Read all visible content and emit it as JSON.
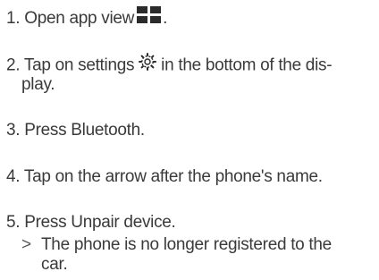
{
  "steps": [
    {
      "number": "1.",
      "before": "Open app view",
      "after": "."
    },
    {
      "number": "2.",
      "before": "Tap on settings",
      "after_line1": "in the bottom of the dis-",
      "line2": "play."
    },
    {
      "number": "3.",
      "text": "Press Bluetooth."
    },
    {
      "number": "4.",
      "text": "Tap on the arrow after the phone's name."
    },
    {
      "number": "5.",
      "text": "Press Unpair device."
    }
  ],
  "result": {
    "marker": ">",
    "line1": "The phone is no longer registered to the",
    "line2": "car."
  },
  "icons": {
    "app_view": "app-grid-icon",
    "settings": "settings-gear-icon"
  },
  "colors": {
    "text": "#3a3a3a",
    "icon": "#2b2b2b"
  }
}
